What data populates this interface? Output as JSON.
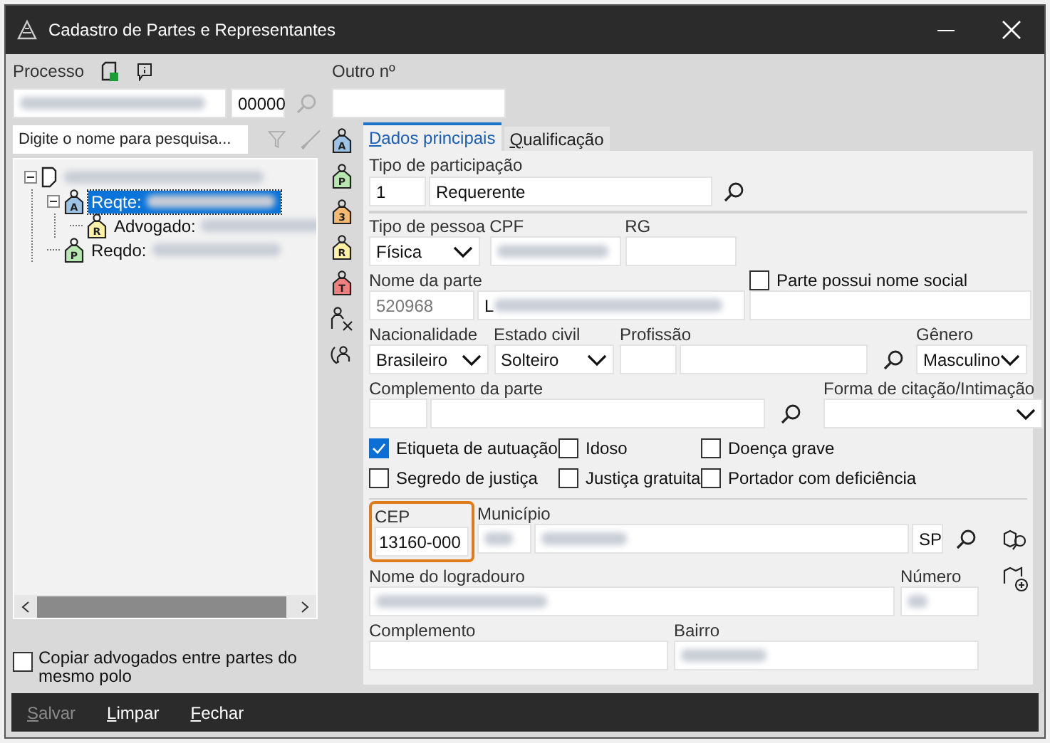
{
  "window": {
    "title": "Cadastro de Partes e Representantes"
  },
  "process": {
    "label": "Processo",
    "suffix": "00000",
    "other_label": "Outro nº"
  },
  "search": {
    "placeholder": "Digite o nome para pesquisa..."
  },
  "tree": [
    {
      "expanded": true,
      "selected": false,
      "children": [
        {
          "label": "Reqte:",
          "letter": "A",
          "color": "#9cc3e6",
          "expanded": true,
          "selected": true,
          "children": [
            {
              "label": "Advogado:",
              "letter": "R",
              "color": "#fff2a8",
              "selected": false
            }
          ]
        },
        {
          "label": "Reqdo:",
          "letter": "P",
          "color": "#b8e6b0",
          "selected": false
        }
      ]
    }
  ],
  "side_tools": [
    {
      "kind": "tag",
      "letter": "A",
      "color": "#9cc3e6"
    },
    {
      "kind": "tag",
      "letter": "P",
      "color": "#b8e6b0"
    },
    {
      "kind": "tag",
      "letter": "3",
      "color": "#f5b971"
    },
    {
      "kind": "tag",
      "letter": "R",
      "color": "#fff2a8"
    },
    {
      "kind": "tag",
      "letter": "T",
      "color": "#f08080"
    },
    {
      "kind": "remove"
    },
    {
      "kind": "swap"
    }
  ],
  "tabs": [
    {
      "label": "Dados principais",
      "selected": true
    },
    {
      "label": "Qualificação",
      "selected": false
    }
  ],
  "participation": {
    "label": "Tipo de participação",
    "code": "1",
    "value": "Requerente"
  },
  "person_type": {
    "label": "Tipo de pessoa",
    "value": "Física"
  },
  "cpf": {
    "label": "CPF"
  },
  "rg": {
    "label": "RG"
  },
  "party_name": {
    "label": "Nome da parte",
    "code": "520968",
    "value": "L"
  },
  "social_name": {
    "label": "Parte possui nome social",
    "checked": false
  },
  "nationality": {
    "label": "Nacionalidade",
    "value": "Brasileiro"
  },
  "civil_status": {
    "label": "Estado civil",
    "value": "Solteiro"
  },
  "profession": {
    "label": "Profissão"
  },
  "gender": {
    "label": "Gênero",
    "value": "Masculino"
  },
  "party_complement": {
    "label": "Complemento da parte"
  },
  "citation_form": {
    "label": "Forma de citação/Intimação"
  },
  "flags": [
    {
      "label": "Etiqueta de autuação",
      "checked": true
    },
    {
      "label": "Idoso",
      "checked": false
    },
    {
      "label": "Doença grave",
      "checked": false
    },
    {
      "label": "Segredo de justiça",
      "checked": false
    },
    {
      "label": "Justiça gratuita",
      "checked": false
    },
    {
      "label": "Portador com deficiência",
      "checked": false
    }
  ],
  "cep": {
    "label": "CEP",
    "value": "13160-000",
    "highlighted": true
  },
  "city": {
    "label": "Município",
    "state": "SP"
  },
  "street": {
    "label": "Nome do logradouro"
  },
  "number": {
    "label": "Número"
  },
  "address_complement": {
    "label": "Complemento"
  },
  "district": {
    "label": "Bairro"
  },
  "copy_lawyers": {
    "label": "Copiar advogados entre partes do mesmo polo",
    "checked": false
  },
  "footer": [
    {
      "label": "Salvar",
      "disabled": true
    },
    {
      "label": "Limpar",
      "disabled": false
    },
    {
      "label": "Fechar",
      "disabled": false
    }
  ]
}
